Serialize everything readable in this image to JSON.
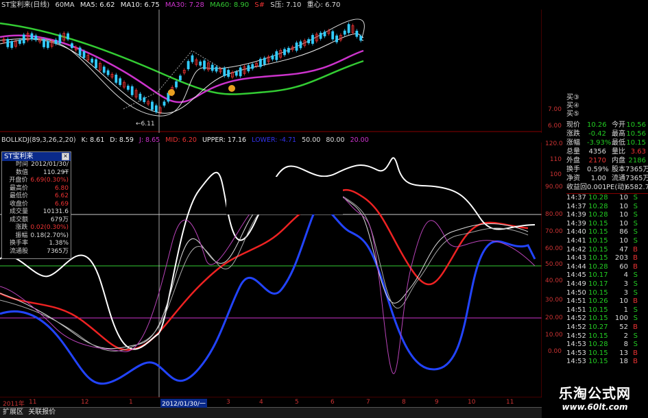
{
  "top_header": {
    "name": "ST宝利来(日线)",
    "ma60": "60MA",
    "ma5": "MA5: 6.62",
    "ma10": "MA10: 6.75",
    "ma30": "MA30: 7.28",
    "ma60v": "MA60: 8.90",
    "sig": "S#",
    "s": "S压: 7.10",
    "gravity": "重心: 6.70"
  },
  "price_annotation": "←6.11",
  "price_axis": [
    "7.00",
    "6.00"
  ],
  "ind_header": {
    "name": "BOLLKDJ(89,3,26,2,20)",
    "k": "K: 8.61",
    "d": "D: 8.59",
    "j": "J: 8.65",
    "mid": "MID: 6.20",
    "upper": "UPPER: 17.16",
    "lower": "LOWER: -4.71",
    "l50": "50.00",
    "l80": "80.00",
    "l20": "20.00"
  },
  "ind_axis": [
    "120.0",
    "110",
    "100",
    "90.00",
    "80.00",
    "70.00",
    "60.00",
    "50.00",
    "40.00",
    "30.00",
    "20.00",
    "10.00",
    "0.00"
  ],
  "info_window": {
    "title": "ST宝利来",
    "rows": [
      {
        "k": "时间",
        "v": "2012/01/30/一",
        "c": "#ddd"
      },
      {
        "k": "数值",
        "v": "110.29T",
        "c": "#ddd"
      },
      {
        "k": "开盘价",
        "v": "6.69(0.30%)",
        "c": "#e33"
      },
      {
        "k": "最高价",
        "v": "6.80",
        "c": "#e33"
      },
      {
        "k": "最低价",
        "v": "6.62",
        "c": "#e33"
      },
      {
        "k": "收盘价",
        "v": "6.69",
        "c": "#e33"
      },
      {
        "k": "成交量",
        "v": "10131.6",
        "c": "#ddd"
      },
      {
        "k": "成交额",
        "v": "679万",
        "c": "#ddd"
      },
      {
        "k": "涨跌",
        "v": "0.02(0.30%)",
        "c": "#e33"
      },
      {
        "k": "振幅",
        "v": "0.18(2.70%)",
        "c": "#ddd"
      },
      {
        "k": "换手率",
        "v": "1.38%",
        "c": "#ddd"
      },
      {
        "k": "流通股",
        "v": "7365万",
        "c": "#ddd"
      }
    ]
  },
  "order_book": [
    "买③",
    "买④",
    "买⑤"
  ],
  "quote": [
    {
      "l1": "现价",
      "v1": "10.26",
      "c1": "#2c2",
      "l2": "今开",
      "v2": "10.56",
      "c2": "#2c2"
    },
    {
      "l1": "涨跌",
      "v1": "-0.42",
      "c1": "#2c2",
      "l2": "最高",
      "v2": "10.56",
      "c2": "#2c2"
    },
    {
      "l1": "涨幅",
      "v1": "-3.93%",
      "c1": "#2c2",
      "l2": "最低",
      "v2": "10.15",
      "c2": "#2c2"
    },
    {
      "l1": "总量",
      "v1": "4356",
      "c1": "#ddd",
      "l2": "量比",
      "v2": "3.63",
      "c2": "#e33"
    },
    {
      "l1": "外盘",
      "v1": "2170",
      "c1": "#e33",
      "l2": "内盘",
      "v2": "2186",
      "c2": "#2c2"
    },
    {
      "l1": "换手",
      "v1": "0.59%",
      "c1": "#ddd",
      "l2": "股本",
      "v2": "7365万",
      "c2": "#ddd"
    },
    {
      "l1": "净资",
      "v1": "1.00",
      "c1": "#ddd",
      "l2": "流通",
      "v2": "7365万",
      "c2": "#ddd"
    },
    {
      "l1": "收益回",
      "v1": "0.001",
      "c1": "#ddd",
      "l2": "PE(动)",
      "v2": "6582.7",
      "c2": "#ddd"
    }
  ],
  "trades": [
    {
      "t": "14:37",
      "p": "10.28",
      "q": "10",
      "s": "S",
      "c": "#2c2"
    },
    {
      "t": "14:37",
      "p": "10.28",
      "q": "10",
      "s": "S",
      "c": "#2c2"
    },
    {
      "t": "14:39",
      "p": "10.28",
      "q": "10",
      "s": "S",
      "c": "#2c2"
    },
    {
      "t": "14:39",
      "p": "10.15",
      "q": "10",
      "s": "S",
      "c": "#2c2"
    },
    {
      "t": "14:40",
      "p": "10.15",
      "q": "86",
      "s": "S",
      "c": "#2c2"
    },
    {
      "t": "14:41",
      "p": "10.15",
      "q": "10",
      "s": "S",
      "c": "#2c2"
    },
    {
      "t": "14:42",
      "p": "10.15",
      "q": "47",
      "s": "B",
      "c": "#e33"
    },
    {
      "t": "14:43",
      "p": "10.15",
      "q": "203",
      "s": "B",
      "c": "#e33"
    },
    {
      "t": "14:44",
      "p": "10.28",
      "q": "60",
      "s": "B",
      "c": "#e33"
    },
    {
      "t": "14:45",
      "p": "10.17",
      "q": "4",
      "s": "S",
      "c": "#2c2"
    },
    {
      "t": "14:49",
      "p": "10.17",
      "q": "3",
      "s": "S",
      "c": "#2c2"
    },
    {
      "t": "14:50",
      "p": "10.15",
      "q": "3",
      "s": "S",
      "c": "#2c2"
    },
    {
      "t": "14:51",
      "p": "10.26",
      "q": "10",
      "s": "B",
      "c": "#e33"
    },
    {
      "t": "14:51",
      "p": "10.15",
      "q": "1",
      "s": "S",
      "c": "#2c2"
    },
    {
      "t": "14:52",
      "p": "10.15",
      "q": "100",
      "s": "S",
      "c": "#2c2"
    },
    {
      "t": "14:52",
      "p": "10.27",
      "q": "52",
      "s": "B",
      "c": "#e33"
    },
    {
      "t": "14:52",
      "p": "10.15",
      "q": "2",
      "s": "S",
      "c": "#2c2"
    },
    {
      "t": "14:53",
      "p": "10.28",
      "q": "8",
      "s": "S",
      "c": "#2c2"
    },
    {
      "t": "14:53",
      "p": "10.15",
      "q": "13",
      "s": "B",
      "c": "#e33"
    },
    {
      "t": "14:53",
      "p": "10.15",
      "q": "18",
      "s": "B",
      "c": "#e33"
    }
  ],
  "x_axis": [
    "2011年",
    "11",
    "12",
    "1",
    "2012/01/30/一",
    "3",
    "4",
    "5",
    "6",
    "7",
    "8",
    "9",
    "10",
    "11"
  ],
  "bottom_bar": {
    "tab1": "扩展区",
    "tab2": "关联报价"
  },
  "watermark": {
    "text": "乐淘公式网",
    "url": "www.60lt.com"
  }
}
